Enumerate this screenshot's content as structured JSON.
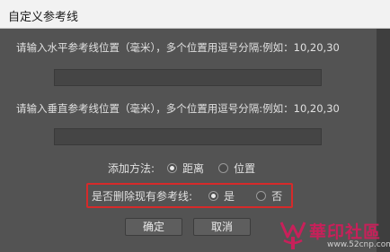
{
  "window": {
    "title": "自定义参考线"
  },
  "horizontal": {
    "label": "请输入水平参考线位置（毫米），多个位置用逗号分隔:例如：10,20,30",
    "value": ""
  },
  "vertical": {
    "label": "请输入垂直参考线位置（毫米），多个位置用逗号分隔:例如：10,20,30",
    "value": ""
  },
  "add_method": {
    "label": "添加方法:",
    "options": [
      {
        "label": "距离",
        "selected": true
      },
      {
        "label": "位置",
        "selected": false
      }
    ]
  },
  "delete_existing": {
    "label": "是否删除现有参考线:",
    "options": [
      {
        "label": "是",
        "selected": true
      },
      {
        "label": "否",
        "selected": false
      }
    ]
  },
  "buttons": {
    "ok": "确定",
    "cancel": "取消"
  },
  "watermark": {
    "text": "華印社區",
    "url": "www.52cnp.com"
  },
  "colors": {
    "highlight": "#d62a2a",
    "watermark": "#c8205a",
    "background": "#535353"
  }
}
